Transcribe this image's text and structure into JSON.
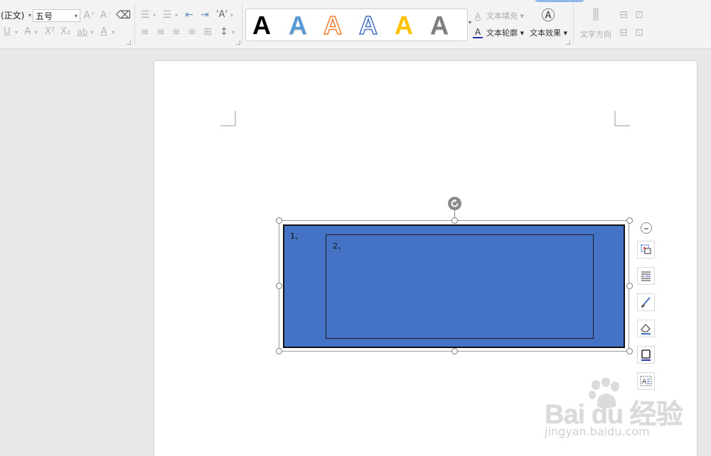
{
  "colors": {
    "shape_fill": "#4472c4",
    "accent": "#8fb6ea"
  },
  "font_group": {
    "font_name": "(正文)",
    "font_size": "五号"
  },
  "text_effects": {
    "fill_label": "文本填充",
    "outline_label": "文本轮廓",
    "effects_label": "文本效果",
    "direction_label": "文字方向"
  },
  "gallery": {
    "glyph": "A",
    "styles": [
      {
        "name": "black-solid",
        "color": "#000000"
      },
      {
        "name": "blue-gradient",
        "color": "#5b9bd5"
      },
      {
        "name": "orange-outline",
        "color": "#ed7d31"
      },
      {
        "name": "blue-outline",
        "color": "#4472c4"
      },
      {
        "name": "gold-solid",
        "color": "#ffc000"
      },
      {
        "name": "gray-gradient",
        "color": "#7f7f7f"
      }
    ]
  },
  "shape": {
    "outer_text": "1、",
    "inner_text": "2、"
  },
  "side_tools": [
    "shape-layout-icon",
    "text-wrap-icon",
    "shape-fill-brush-icon",
    "shape-outline-icon",
    "border-icon",
    "text-box-icon"
  ],
  "watermark": {
    "brand": "Bai du 经验",
    "url": "jingyan.baidu.com"
  }
}
